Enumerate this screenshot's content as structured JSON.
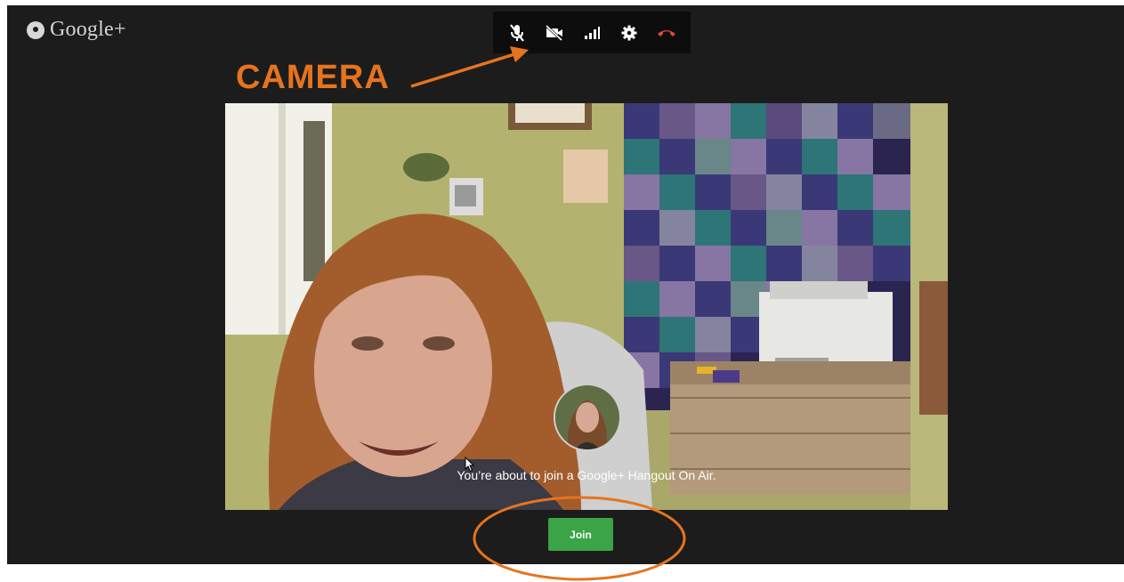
{
  "brand": {
    "name": "Google+",
    "icon": "hangouts-quote-icon"
  },
  "toolbar": {
    "items": [
      {
        "name": "microphone-muted-icon",
        "color": "#ffffff"
      },
      {
        "name": "camera-off-icon",
        "color": "#ffffff"
      },
      {
        "name": "bandwidth-signal-icon",
        "color": "#ffffff"
      },
      {
        "name": "settings-gear-icon",
        "color": "#ffffff"
      },
      {
        "name": "hang-up-icon",
        "color": "#e0483a"
      }
    ]
  },
  "annotation": {
    "label": "CAMERA",
    "color": "#e6741e"
  },
  "main": {
    "join_message": "You’re about to join a Google+ Hangout On Air.",
    "join_button_label": "Join",
    "join_button_color": "#3aa447"
  }
}
